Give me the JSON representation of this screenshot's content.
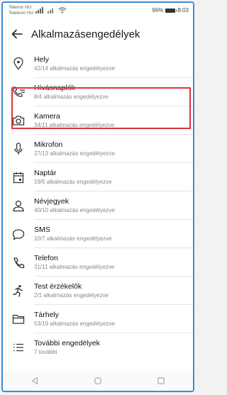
{
  "status": {
    "carrier_line1": "Telenor HU",
    "carrier_line2": "Telekom HU",
    "battery_percent": "96%",
    "time": "8:03"
  },
  "app_bar": {
    "title": "Alkalmazásengedélyek"
  },
  "items": [
    {
      "icon": "location-icon",
      "label": "Hely",
      "sub": "42/14 alkalmazás engedélyezve"
    },
    {
      "icon": "call-log-icon",
      "label": "Hívásnaplók",
      "sub": "8/4 alkalmazás engedélyezve"
    },
    {
      "icon": "camera-icon",
      "label": "Kamera",
      "sub": "34/11 alkalmazás engedélyezve"
    },
    {
      "icon": "microphone-icon",
      "label": "Mikrofon",
      "sub": "27/13 alkalmazás engedélyezve"
    },
    {
      "icon": "calendar-icon",
      "label": "Naptár",
      "sub": "19/5 alkalmazás engedélyezve"
    },
    {
      "icon": "contacts-icon",
      "label": "Névjegyek",
      "sub": "40/10 alkalmazás engedélyezve"
    },
    {
      "icon": "sms-icon",
      "label": "SMS",
      "sub": "10/7 alkalmazás engedélyezve"
    },
    {
      "icon": "phone-icon",
      "label": "Telefon",
      "sub": "31/11 alkalmazás engedélyezve"
    },
    {
      "icon": "body-sensor-icon",
      "label": "Test érzékelők",
      "sub": "2/1 alkalmazás engedélyezve"
    },
    {
      "icon": "storage-folder-icon",
      "label": "Tárhely",
      "sub": "53/19 alkalmazás engedélyezve"
    },
    {
      "icon": "more-permissions-icon",
      "label": "További engedélyek",
      "sub": "7 további"
    }
  ],
  "colors": {
    "highlight": "#d9363e",
    "frame": "#3a8fd8"
  }
}
